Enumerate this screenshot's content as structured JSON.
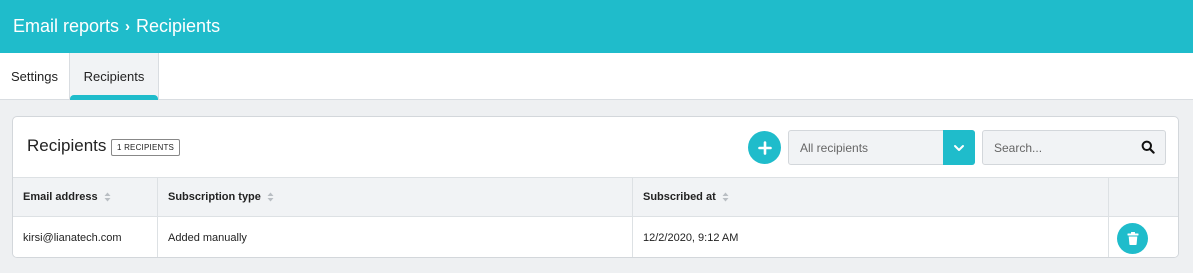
{
  "header": {
    "breadcrumb": [
      {
        "label": "Email reports"
      },
      {
        "label": "Recipients"
      }
    ],
    "separator": "›"
  },
  "tabs": [
    {
      "label": "Settings",
      "active": false
    },
    {
      "label": "Recipients",
      "active": true
    }
  ],
  "recipients_panel": {
    "title": "Recipients",
    "count_badge": "1 RECIPIENTS",
    "add_icon": "plus-icon",
    "filter": {
      "selected": "All recipients",
      "icon": "chevron-down-icon"
    },
    "search": {
      "placeholder": "Search...",
      "value": "",
      "icon": "search-icon"
    },
    "table": {
      "columns": [
        {
          "label": "Email address",
          "sortable": true
        },
        {
          "label": "Subscription type",
          "sortable": true
        },
        {
          "label": "Subscribed at",
          "sortable": true
        },
        {
          "label": "",
          "sortable": false
        }
      ],
      "rows": [
        {
          "email": "kirsi@lianatech.com",
          "subscription_type": "Added manually",
          "subscribed_at": "12/2/2020, 9:12 AM",
          "action_icon": "trash-icon"
        }
      ]
    }
  },
  "colors": {
    "accent": "#1fbccb",
    "background": "#eef0f2",
    "table_header_bg": "#f1f3f5"
  }
}
